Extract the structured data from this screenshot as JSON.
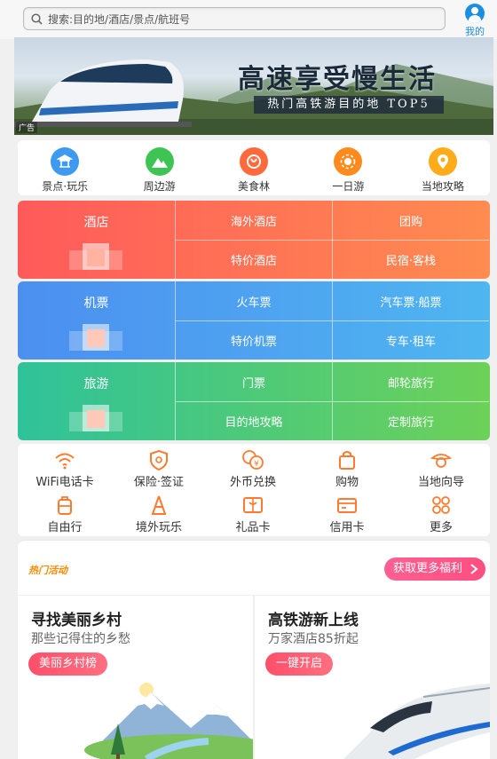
{
  "search": {
    "placeholder": "搜索:目的地/酒店/景点/航班号"
  },
  "profile": {
    "label": "我的"
  },
  "banner": {
    "title": "高速享受慢生活",
    "subtitle": "热门高铁游目的地 TOP5",
    "ad_label": "广告"
  },
  "quick_nav": [
    {
      "label": "景点·玩乐",
      "color": "#3d9af0",
      "icon": "pavilion-icon"
    },
    {
      "label": "周边游",
      "color": "#3ec452",
      "icon": "mountain-icon"
    },
    {
      "label": "美食林",
      "color": "#ff6a3d",
      "icon": "food-icon"
    },
    {
      "label": "一日游",
      "color": "#ff8a1e",
      "icon": "sun-icon"
    },
    {
      "label": "当地攻略",
      "color": "#ffab1a",
      "icon": "location-icon"
    }
  ],
  "grid": {
    "hotel": {
      "main": "酒店",
      "cells": [
        "海外酒店",
        "团购",
        "特价酒店",
        "民宿·客栈"
      ]
    },
    "flight": {
      "main": "机票",
      "cells": [
        "火车票",
        "汽车票·船票",
        "特价机票",
        "专车·租车"
      ]
    },
    "travel": {
      "main": "旅游",
      "cells": [
        "门票",
        "邮轮旅行",
        "目的地攻略",
        "定制旅行"
      ]
    }
  },
  "services": [
    {
      "label": "WiFi电话卡",
      "icon": "wifi-icon"
    },
    {
      "label": "保险·签证",
      "icon": "shield-icon"
    },
    {
      "label": "外币兑换",
      "icon": "currency-icon"
    },
    {
      "label": "购物",
      "icon": "bag-icon"
    },
    {
      "label": "当地向导",
      "icon": "guide-icon"
    },
    {
      "label": "自由行",
      "icon": "luggage-icon"
    },
    {
      "label": "境外玩乐",
      "icon": "tower-icon"
    },
    {
      "label": "礼品卡",
      "icon": "gift-card-icon"
    },
    {
      "label": "信用卡",
      "icon": "credit-card-icon"
    },
    {
      "label": "更多",
      "icon": "more-icon"
    }
  ],
  "hot": {
    "tag": "热门活动",
    "more": "获取更多福利"
  },
  "cards": [
    {
      "title": "寻找美丽乡村",
      "desc": "那些记得住的乡愁",
      "button": "美丽乡村榜"
    },
    {
      "title": "高铁游新上线",
      "desc": "万家酒店85折起",
      "button": "一键开启"
    }
  ],
  "colors": {
    "hotel": [
      "#ff5a5a",
      "#ff8c50"
    ],
    "flight": [
      "#4c8ff0",
      "#4fb6f0"
    ],
    "travel": [
      "#2fc29a",
      "#6dd158"
    ],
    "service_icon": "#ff7a2e"
  }
}
